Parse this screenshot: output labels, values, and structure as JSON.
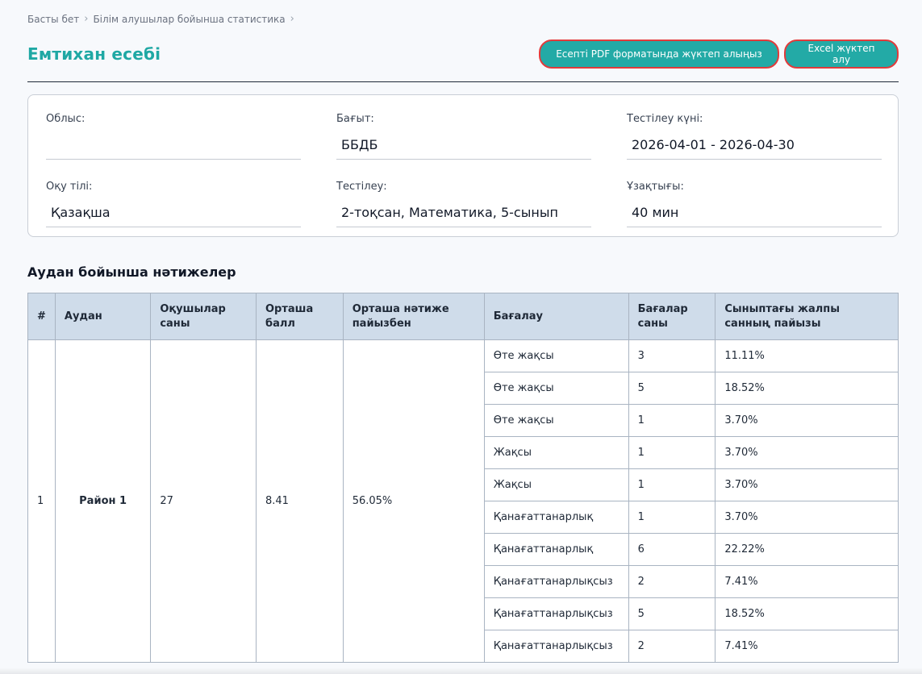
{
  "breadcrumb": {
    "items": [
      "Басты бет",
      "Білім алушылар бойынша статистика"
    ]
  },
  "header": {
    "title": "Емтихан есебі",
    "pdf_button": "Есепті PDF форматында жүктеп алыңыз",
    "excel_button": "Excel жүктеп алу"
  },
  "filters": {
    "region": {
      "label": "Облыс:",
      "value": ""
    },
    "direction": {
      "label": "Бағыт:",
      "value": "ББДБ"
    },
    "test_date": {
      "label": "Тестілеу күні:",
      "value": "2026-04-01 - 2026-04-30"
    },
    "language": {
      "label": "Оқу тілі:",
      "value": "Қазақша"
    },
    "testing": {
      "label": "Тестілеу:",
      "value": "2-тоқсан, Математика, 5-сынып"
    },
    "duration": {
      "label": "Ұзақтығы:",
      "value": "40 мин"
    }
  },
  "results": {
    "title": "Аудан бойынша нәтижелер",
    "columns": [
      "#",
      "Аудан",
      "Оқушылар саны",
      "Орташа балл",
      "Орташа нәтиже пайызбен",
      "Бағалау",
      "Бағалар саны",
      "Сыныптағы жалпы санның пайызы"
    ],
    "row": {
      "index": "1",
      "district": "Район 1",
      "students": "27",
      "avg_score": "8.41",
      "avg_percent": "56.05%"
    },
    "grades": [
      {
        "grade": "Өте жақсы",
        "count": "3",
        "percent": "11.11%"
      },
      {
        "grade": "Өте жақсы",
        "count": "5",
        "percent": "18.52%"
      },
      {
        "grade": "Өте жақсы",
        "count": "1",
        "percent": "3.70%"
      },
      {
        "grade": "Жақсы",
        "count": "1",
        "percent": "3.70%"
      },
      {
        "grade": "Жақсы",
        "count": "1",
        "percent": "3.70%"
      },
      {
        "grade": "Қанағаттанарлық",
        "count": "1",
        "percent": "3.70%"
      },
      {
        "grade": "Қанағаттанарлық",
        "count": "6",
        "percent": "22.22%"
      },
      {
        "grade": "Қанағаттанарлықсыз",
        "count": "2",
        "percent": "7.41%"
      },
      {
        "grade": "Қанағаттанарлықсыз",
        "count": "5",
        "percent": "18.52%"
      },
      {
        "grade": "Қанағаттанарлықсыз",
        "count": "2",
        "percent": "7.41%"
      }
    ]
  }
}
